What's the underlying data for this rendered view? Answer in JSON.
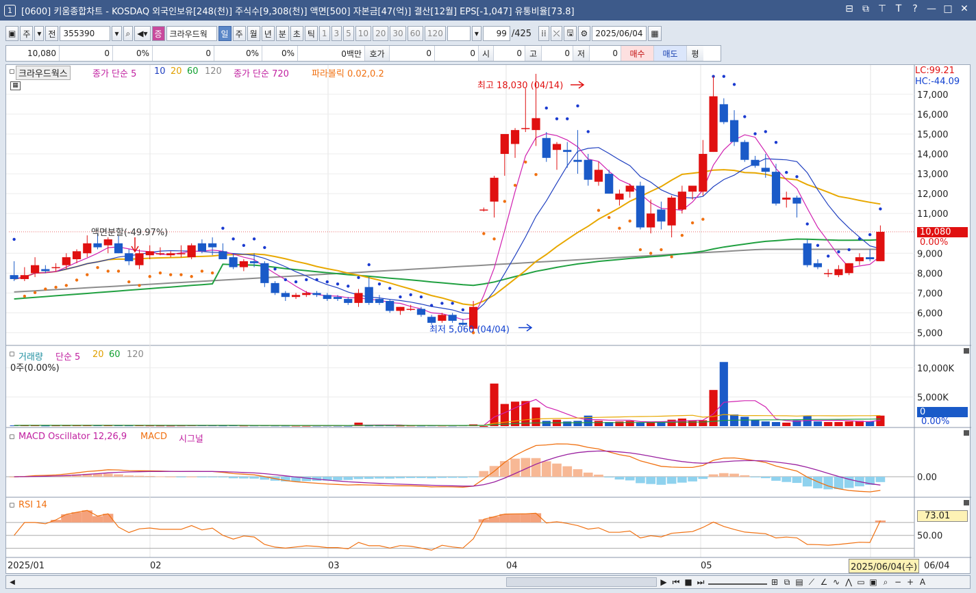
{
  "window": {
    "number": "1",
    "title": "[0600] 키움종합차트 - KOSDAQ 외국인보유[248(천)] 주식수[9,308(천)] 액면[500] 자본금[47(억)] 결산[12월] EPS[-1,047] 유통비율[73.8]",
    "buttons": [
      "⊟",
      "⧉",
      "⊤",
      "T",
      "?",
      "—",
      "□",
      "✕"
    ]
  },
  "toolbar": {
    "type_label": "주",
    "all_label": "전",
    "code": "355390",
    "stock_name": "크라우드웍",
    "periods": [
      "일",
      "주",
      "월",
      "년",
      "분",
      "초",
      "틱"
    ],
    "selected_period": "일",
    "intervals": [
      "1",
      "3",
      "5",
      "10",
      "20",
      "30",
      "60",
      "120"
    ],
    "count": "99",
    "total": "/425",
    "date": "2025/06/04"
  },
  "quote": {
    "price": "10,080",
    "change": "0",
    "change_pct": "0%",
    "volume": "0",
    "vol_pct": "0%",
    "vol_pct2": "0%",
    "amount": "0백만",
    "hoga_label": "호가",
    "hoga1": "0",
    "hoga2": "0",
    "open_label": "시",
    "open": "0",
    "high_label": "고",
    "high": "0",
    "low_label": "저",
    "low": "0",
    "buy": "매수",
    "sell": "매도",
    "flat": "평"
  },
  "price_panel": {
    "legend_name": "크라우드웍스",
    "legend_ma": "종가 단순 5",
    "legend_ma_periods": [
      "10",
      "20",
      "60",
      "120"
    ],
    "legend_ma720": "종가 단순 720",
    "legend_sar": "파라볼릭 0.02,0.2",
    "lc": "LC:99.21",
    "hc": "HC:-44.09",
    "high_label": "최고 18,030 (04/14)",
    "low_label": "최저 5,060 (04/04)",
    "split_label": "액면분할(-49.97%)",
    "current_price": "10,080",
    "current_pct": "0.00%",
    "y_ticks": [
      "17,000",
      "16,000",
      "15,000",
      "14,000",
      "13,000",
      "12,000",
      "11,000",
      "9,000",
      "8,000",
      "7,000",
      "6,000",
      "5,000"
    ]
  },
  "volume_panel": {
    "legend_name": "거래량",
    "legend_ma": "단순 5",
    "legend_ma_periods": [
      "20",
      "60",
      "120"
    ],
    "info": "0주(0.00%)",
    "y_ticks": [
      "10,000K",
      "5,000K"
    ],
    "current": "0",
    "current_pct": "0.00%"
  },
  "macd_panel": {
    "legend": "MACD Oscillator 12,26,9",
    "legend_macd": "MACD",
    "legend_signal": "시그널",
    "y_tick": "0.00"
  },
  "rsi_panel": {
    "legend": "RSI 14",
    "current": "73.01",
    "y_tick": "50.00"
  },
  "x_axis": {
    "labels": [
      "2025/01",
      "02",
      "03",
      "04",
      "05",
      "06/04"
    ],
    "cursor_date": "2025/06/04(수)"
  },
  "chart_data": {
    "type": "candlestick",
    "ylim": [
      4500,
      18200
    ],
    "candles": [
      {
        "o": 7900,
        "h": 8600,
        "l": 7600,
        "c": 7700
      },
      {
        "o": 7700,
        "h": 8300,
        "l": 7600,
        "c": 7900
      },
      {
        "o": 8000,
        "h": 8800,
        "l": 7800,
        "c": 8400
      },
      {
        "o": 8200,
        "h": 8400,
        "l": 8000,
        "c": 8100
      },
      {
        "o": 8250,
        "h": 8500,
        "l": 8100,
        "c": 8300
      },
      {
        "o": 8400,
        "h": 9000,
        "l": 8200,
        "c": 8800
      },
      {
        "o": 8700,
        "h": 9200,
        "l": 8500,
        "c": 9100
      },
      {
        "o": 9000,
        "h": 9900,
        "l": 8800,
        "c": 9500
      },
      {
        "o": 9500,
        "h": 10000,
        "l": 9200,
        "c": 9300
      },
      {
        "o": 9400,
        "h": 9800,
        "l": 9000,
        "c": 9700
      },
      {
        "o": 9500,
        "h": 9900,
        "l": 9000,
        "c": 9000
      },
      {
        "o": 9000,
        "h": 9200,
        "l": 8400,
        "c": 8600
      },
      {
        "o": 8400,
        "h": 9200,
        "l": 8200,
        "c": 9000
      },
      {
        "o": 8900,
        "h": 9400,
        "l": 8700,
        "c": 9100
      },
      {
        "o": 9000,
        "h": 9300,
        "l": 8900,
        "c": 9000
      },
      {
        "o": 8900,
        "h": 9100,
        "l": 8800,
        "c": 9000
      },
      {
        "o": 9000,
        "h": 9400,
        "l": 8800,
        "c": 9000
      },
      {
        "o": 8800,
        "h": 9500,
        "l": 8700,
        "c": 9400
      },
      {
        "o": 9500,
        "h": 9700,
        "l": 9000,
        "c": 9100
      },
      {
        "o": 9500,
        "h": 9800,
        "l": 8900,
        "c": 9300
      },
      {
        "o": 9100,
        "h": 9500,
        "l": 8700,
        "c": 8700
      },
      {
        "o": 8800,
        "h": 9000,
        "l": 8200,
        "c": 8300
      },
      {
        "o": 8300,
        "h": 8700,
        "l": 8100,
        "c": 8600
      },
      {
        "o": 8600,
        "h": 9000,
        "l": 8300,
        "c": 8500
      },
      {
        "o": 8500,
        "h": 8600,
        "l": 7300,
        "c": 7500
      },
      {
        "o": 7500,
        "h": 7600,
        "l": 6900,
        "c": 7000
      },
      {
        "o": 7000,
        "h": 7100,
        "l": 6600,
        "c": 6800
      },
      {
        "o": 6800,
        "h": 7000,
        "l": 6700,
        "c": 6900
      },
      {
        "o": 6900,
        "h": 7100,
        "l": 6800,
        "c": 7000
      },
      {
        "o": 7000,
        "h": 7100,
        "l": 6800,
        "c": 6900
      },
      {
        "o": 6900,
        "h": 7000,
        "l": 6600,
        "c": 6700
      },
      {
        "o": 6800,
        "h": 6900,
        "l": 6600,
        "c": 6700
      },
      {
        "o": 6700,
        "h": 6800,
        "l": 6400,
        "c": 6500
      },
      {
        "o": 6500,
        "h": 7200,
        "l": 6300,
        "c": 7000
      },
      {
        "o": 7300,
        "h": 7800,
        "l": 6400,
        "c": 6500
      },
      {
        "o": 6700,
        "h": 6900,
        "l": 6400,
        "c": 6500
      },
      {
        "o": 6600,
        "h": 6700,
        "l": 6000,
        "c": 6100
      },
      {
        "o": 6100,
        "h": 6300,
        "l": 5900,
        "c": 6300
      },
      {
        "o": 6200,
        "h": 6400,
        "l": 6100,
        "c": 6200
      },
      {
        "o": 6200,
        "h": 6300,
        "l": 5800,
        "c": 5900
      },
      {
        "o": 5800,
        "h": 5900,
        "l": 5400,
        "c": 5500
      },
      {
        "o": 5600,
        "h": 6000,
        "l": 5500,
        "c": 5900
      },
      {
        "o": 5900,
        "h": 6000,
        "l": 5500,
        "c": 5600
      },
      {
        "o": 5500,
        "h": 5700,
        "l": 5300,
        "c": 5400
      },
      {
        "o": 5200,
        "h": 6600,
        "l": 5060,
        "c": 6300
      },
      {
        "o": 11200,
        "h": 11300,
        "l": 11100,
        "c": 11200
      },
      {
        "o": 11600,
        "h": 12900,
        "l": 10800,
        "c": 12800
      },
      {
        "o": 14000,
        "h": 15000,
        "l": 12900,
        "c": 15000
      },
      {
        "o": 14500,
        "h": 15300,
        "l": 13800,
        "c": 15200
      },
      {
        "o": 15300,
        "h": 17300,
        "l": 15100,
        "c": 15300
      },
      {
        "o": 15200,
        "h": 18030,
        "l": 14400,
        "c": 15800
      },
      {
        "o": 14800,
        "h": 15100,
        "l": 13600,
        "c": 13800
      },
      {
        "o": 14200,
        "h": 14600,
        "l": 13200,
        "c": 14500
      },
      {
        "o": 14200,
        "h": 14600,
        "l": 13300,
        "c": 14100
      },
      {
        "o": 13700,
        "h": 15200,
        "l": 13000,
        "c": 13600
      },
      {
        "o": 13700,
        "h": 14000,
        "l": 12400,
        "c": 12700
      },
      {
        "o": 12600,
        "h": 13600,
        "l": 12400,
        "c": 13200
      },
      {
        "o": 13000,
        "h": 13200,
        "l": 12000,
        "c": 12000
      },
      {
        "o": 11700,
        "h": 12200,
        "l": 11400,
        "c": 12000
      },
      {
        "o": 12100,
        "h": 12500,
        "l": 11800,
        "c": 12400
      },
      {
        "o": 12400,
        "h": 12600,
        "l": 10200,
        "c": 10300
      },
      {
        "o": 10300,
        "h": 11700,
        "l": 10000,
        "c": 11000
      },
      {
        "o": 11200,
        "h": 11600,
        "l": 10200,
        "c": 10600
      },
      {
        "o": 10400,
        "h": 11900,
        "l": 9800,
        "c": 11800
      },
      {
        "o": 11200,
        "h": 12400,
        "l": 11000,
        "c": 12100
      },
      {
        "o": 12100,
        "h": 12400,
        "l": 11700,
        "c": 12400
      },
      {
        "o": 12100,
        "h": 14700,
        "l": 11900,
        "c": 14000
      },
      {
        "o": 14100,
        "h": 17900,
        "l": 14100,
        "c": 16900
      },
      {
        "o": 16500,
        "h": 16800,
        "l": 15500,
        "c": 15600
      },
      {
        "o": 15700,
        "h": 16200,
        "l": 14400,
        "c": 14600
      },
      {
        "o": 14600,
        "h": 14700,
        "l": 13600,
        "c": 13700
      },
      {
        "o": 13700,
        "h": 13900,
        "l": 13300,
        "c": 13400
      },
      {
        "o": 13300,
        "h": 14000,
        "l": 12800,
        "c": 13100
      },
      {
        "o": 13100,
        "h": 13500,
        "l": 11400,
        "c": 11500
      },
      {
        "o": 11700,
        "h": 12100,
        "l": 11300,
        "c": 11800
      },
      {
        "o": 11800,
        "h": 11900,
        "l": 10800,
        "c": 11500
      },
      {
        "o": 9500,
        "h": 9700,
        "l": 8300,
        "c": 8400
      },
      {
        "o": 8500,
        "h": 8700,
        "l": 8200,
        "c": 8300
      },
      {
        "o": 8000,
        "h": 8200,
        "l": 7800,
        "c": 8000
      },
      {
        "o": 7900,
        "h": 8400,
        "l": 7800,
        "c": 8200
      },
      {
        "o": 8000,
        "h": 8500,
        "l": 7900,
        "c": 8500
      },
      {
        "o": 8600,
        "h": 9000,
        "l": 8400,
        "c": 8800
      },
      {
        "o": 8800,
        "h": 9200,
        "l": 8600,
        "c": 8700
      },
      {
        "o": 8600,
        "h": 10400,
        "l": 8600,
        "c": 10080
      }
    ],
    "volume": [
      120,
      140,
      180,
      90,
      110,
      150,
      160,
      200,
      150,
      130,
      120,
      110,
      140,
      100,
      90,
      80,
      100,
      130,
      120,
      110,
      100,
      120,
      90,
      100,
      110,
      90,
      80,
      70,
      60,
      70,
      80,
      70,
      60,
      600,
      90,
      100,
      110,
      80,
      90,
      80,
      100,
      90,
      80,
      110,
      300,
      0,
      7300,
      3800,
      4200,
      4300,
      3200,
      900,
      1100,
      800,
      900,
      1800,
      900,
      700,
      800,
      900,
      600,
      700,
      800,
      1100,
      1300,
      900,
      1000,
      6200,
      11000,
      2000,
      1600,
      1000,
      800,
      700,
      600,
      1000,
      1800,
      800,
      700,
      700,
      800,
      900,
      800,
      1800
    ],
    "rsi_last": 73.01
  }
}
